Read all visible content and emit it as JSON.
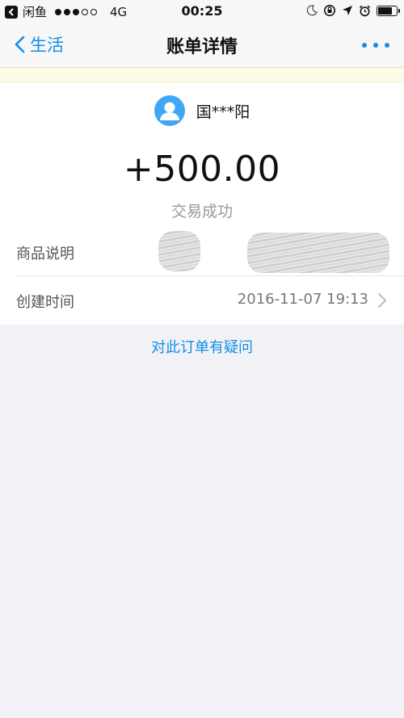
{
  "status_bar": {
    "back_app": "闲鱼",
    "network": "4G",
    "time": "00:25",
    "icons": [
      "moon-icon",
      "rotation-lock-icon",
      "location-arrow-icon",
      "alarm-icon",
      "battery-icon"
    ],
    "battery_level": 0.75
  },
  "nav": {
    "back_label": "生活",
    "title": "账单详情",
    "more_icon": "more-dots-icon",
    "accent": "#108ee9"
  },
  "payer": {
    "name": "国***阳",
    "avatar_icon": "user-avatar-icon",
    "avatar_color": "#3fa7f3"
  },
  "amount": "+500.00",
  "trade_status": "交易成功",
  "details": [
    {
      "label": "商品说明",
      "value": ""
    },
    {
      "label": "创建时间",
      "value": "2016-11-07 19:13"
    }
  ],
  "dispute_link": "对此订单有疑问"
}
